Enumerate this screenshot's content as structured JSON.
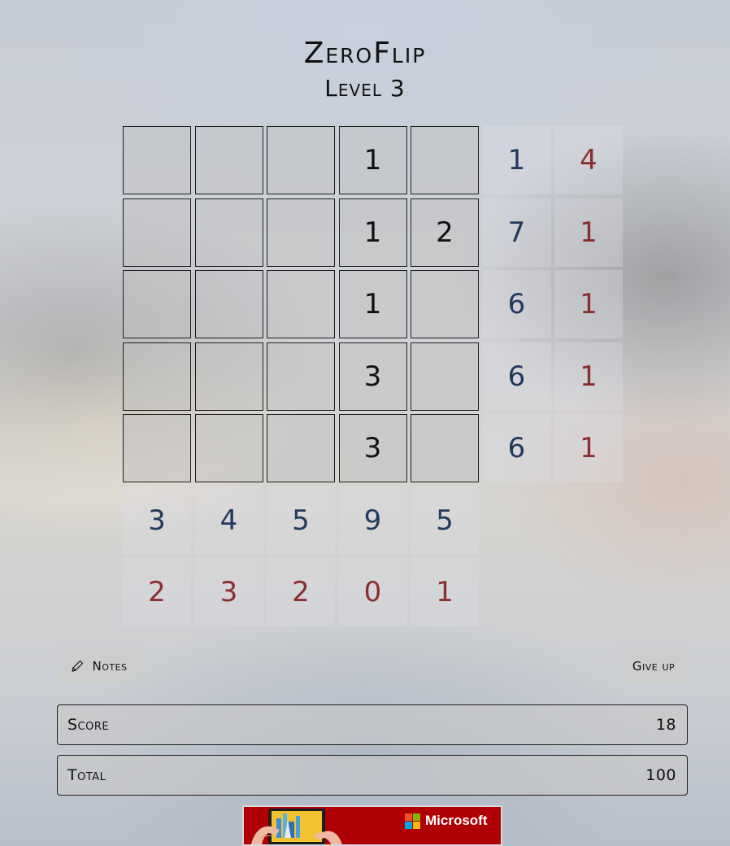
{
  "header": {
    "title": "ZeroFlip",
    "level": "Level 3"
  },
  "board": {
    "tiles": [
      [
        "",
        "",
        "",
        "1",
        ""
      ],
      [
        "",
        "",
        "",
        "1",
        "2"
      ],
      [
        "",
        "",
        "",
        "1",
        ""
      ],
      [
        "",
        "",
        "",
        "3",
        ""
      ],
      [
        "",
        "",
        "",
        "3",
        ""
      ]
    ],
    "row_hints": [
      {
        "sum": "1",
        "zeros": "4"
      },
      {
        "sum": "7",
        "zeros": "1"
      },
      {
        "sum": "6",
        "zeros": "1"
      },
      {
        "sum": "6",
        "zeros": "1"
      },
      {
        "sum": "6",
        "zeros": "1"
      }
    ],
    "col_hints": [
      {
        "sum": "3",
        "zeros": "2"
      },
      {
        "sum": "4",
        "zeros": "3"
      },
      {
        "sum": "5",
        "zeros": "2"
      },
      {
        "sum": "9",
        "zeros": "0"
      },
      {
        "sum": "5",
        "zeros": "1"
      }
    ]
  },
  "controls": {
    "notes_label": "Notes",
    "notes_icon": "pencil-icon",
    "give_up_label": "Give up"
  },
  "stats": {
    "score_label": "Score",
    "score_value": "18",
    "total_label": "Total",
    "total_value": "100"
  },
  "ad": {
    "brand": "Microsoft"
  },
  "colors": {
    "sum_hint": "#233a5e",
    "zero_hint": "#8a2f2f",
    "ad_background": "#b00006",
    "ms_red": "#f25022",
    "ms_green": "#7fba00",
    "ms_blue": "#00a4ef",
    "ms_yellow": "#ffb900"
  }
}
